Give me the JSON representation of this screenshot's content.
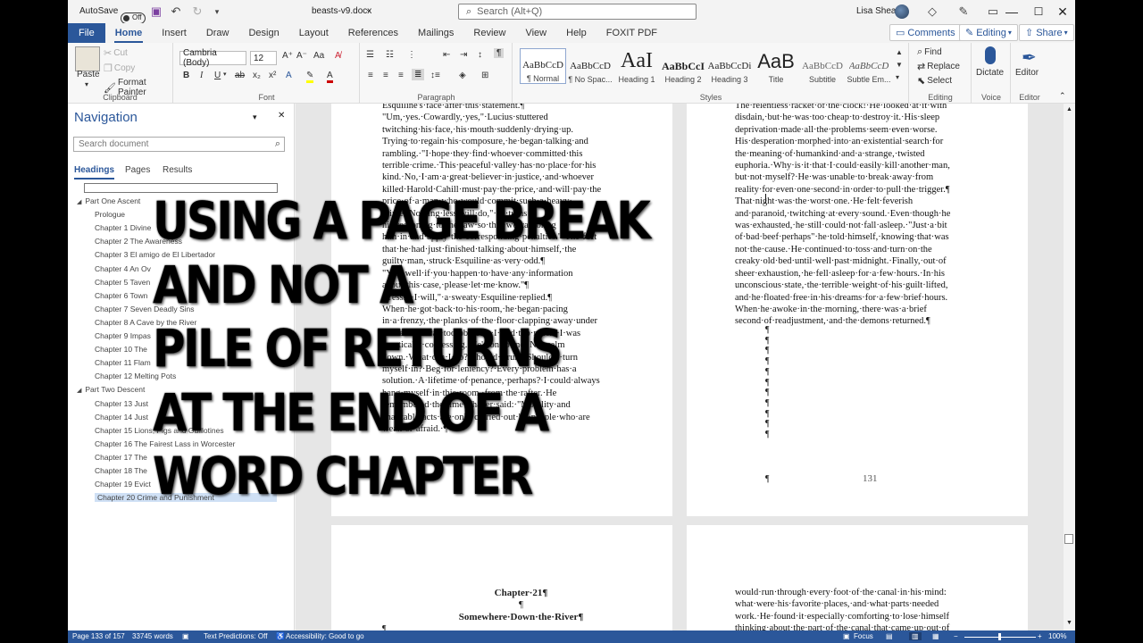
{
  "titlebar": {
    "autosave_label": "AutoSave",
    "autosave_state": "Off",
    "filename": "beasts-v9.docx",
    "search_placeholder": "Search (Alt+Q)",
    "user_name": "Lisa Shea"
  },
  "tabs": [
    "File",
    "Home",
    "Insert",
    "Draw",
    "Design",
    "Layout",
    "References",
    "Mailings",
    "Review",
    "View",
    "Help",
    "FOXIT PDF"
  ],
  "active_tab": "Home",
  "header_buttons": {
    "comments": "Comments",
    "editing": "Editing",
    "share": "Share"
  },
  "ribbon": {
    "clipboard": {
      "paste": "Paste",
      "cut": "Cut",
      "copy": "Copy",
      "format_painter": "Format Painter",
      "label": "Clipboard"
    },
    "font": {
      "family": "Cambria (Body)",
      "size": "12",
      "label": "Font"
    },
    "paragraph": {
      "label": "Paragraph"
    },
    "styles": {
      "label": "Styles",
      "items": [
        {
          "sample": "AaBbCcD",
          "name": "¶ Normal"
        },
        {
          "sample": "AaBbCcD",
          "name": "¶ No Spac..."
        },
        {
          "sample": "AaI",
          "name": "Heading 1"
        },
        {
          "sample": "AaBbCcI",
          "name": "Heading 2"
        },
        {
          "sample": "AaBbCcDi",
          "name": "Heading 3"
        },
        {
          "sample": "AaB",
          "name": "Title"
        },
        {
          "sample": "AaBbCcD",
          "name": "Subtitle"
        },
        {
          "sample": "AaBbCcD",
          "name": "Subtle Em..."
        }
      ]
    },
    "editing": {
      "find": "Find",
      "replace": "Replace",
      "select": "Select",
      "label": "Editing"
    },
    "voice": {
      "dictate": "Dictate",
      "label": "Voice"
    },
    "editor": {
      "editor": "Editor",
      "label": "Editor"
    }
  },
  "navigation": {
    "title": "Navigation",
    "search_placeholder": "Search document",
    "tabs": [
      "Headings",
      "Pages",
      "Results"
    ],
    "active_tab": "Headings",
    "headings": [
      {
        "level": 1,
        "text": "Part One  Ascent"
      },
      {
        "level": 2,
        "text": "Prologue"
      },
      {
        "level": 2,
        "text": "Chapter 1  Divine"
      },
      {
        "level": 2,
        "text": "Chapter 2  The Awareness"
      },
      {
        "level": 2,
        "text": "Chapter 3   El amigo de El Libertador"
      },
      {
        "level": 2,
        "text": "Chapter 4   An Ov"
      },
      {
        "level": 2,
        "text": "Chapter 5  Taven"
      },
      {
        "level": 2,
        "text": "Chapter 6  Town"
      },
      {
        "level": 2,
        "text": "Chapter 7  Seven Deadly Sins"
      },
      {
        "level": 2,
        "text": "Chapter 8  A Cave by the River"
      },
      {
        "level": 2,
        "text": "Chapter 9  Impas"
      },
      {
        "level": 2,
        "text": "Chapter 10  The"
      },
      {
        "level": 2,
        "text": "Chapter 11  Flam"
      },
      {
        "level": 2,
        "text": "Chapter 12  Melting Pots"
      },
      {
        "level": 1,
        "text": "Part Two  Descent"
      },
      {
        "level": 2,
        "text": "Chapter 13  Just"
      },
      {
        "level": 2,
        "text": "Chapter 14  Just"
      },
      {
        "level": 2,
        "text": "Chapter 15  Lions, Pigs and Guillotines"
      },
      {
        "level": 2,
        "text": "Chapter 16  The Fairest Lass in Worcester"
      },
      {
        "level": 2,
        "text": "Chapter 17  The"
      },
      {
        "level": 2,
        "text": "Chapter 18  The"
      },
      {
        "level": 2,
        "text": "Chapter 19  Evict"
      },
      {
        "level": 2,
        "text": "Chapter 20  Crime and Punishment"
      }
    ],
    "selected_index": 22
  },
  "document": {
    "left_page_lines": [
      "Esquiline's·face·after·this·statement.¶",
      "      \"Um,·yes.·Cowardly,·yes,\"·Lucius·stuttered",
      "twitching·his·face,·his·mouth·suddenly·drying·up.",
      "Trying·to·regain·his·composure,·he·began·talking·and",
      "rambling.·\"I·hope·they·find·whoever·committed·this",
      "terrible·crime.·This·peaceful·valley·has·no·place·for·his",
      "kind.·No,·I·am·a·great·believer·in·justice,·and·whoever",
      "killed·Harold·Cahill·must·pay·the·price,·and·will·pay·the",
      "price·of·a·man·who·would·commit·such·a·heavy·",
      "crime.·Nothing·less·will·do,\"·he·turns",
      "his·reasoning·to·the·law·so·that·we·can·bring",
      "him·in·and·apply·the·corresponding·penalties.\"·The·fact",
      "that·he·had·just·finished·talking·about·himself,·the",
      "guilty·man,·struck·Esquiline·as·very·odd.¶",
      "      \"Yes,·well·if·you·happen·to·have·any·information",
      "about·this·case,·please·let·me·know.\"¶",
      "      \"Yessir,·I·will,\"·a·sweaty·Esquiline·replied.¶",
      "      When·he·got·back·to·his·room,·he·began·pacing",
      "in·a·frenzy,·the·planks·of·the·floor·clapping·away·under",
      "his·feet.·\"I·was·too·obvious.·I·said·too·much.·I·was",
      "practically·confessing.·He's·on·to·me.·No,·calm",
      "down.·What·can·I·do?·Should·I·run?·Should·I·turn",
      "myself·in?·Beg·for·leniency?·Every·problem·has·a",
      "solution.·A·lifetime·of·penance,·perhaps?·I·could·always",
      "hang·myself·in·this·room,·from·the·rafter.·He",
      "remembered·the·time·Thayer·said:·\"Morality·and",
      "charitable·acts·are·only·carried·out·by·people·who·are",
      "weak·or·afraid.·¶"
    ],
    "left_page_number": "130",
    "right_page_lines": [
      "The·relentless·racket·of·the·clock!·He·looked·at·it·with",
      "disdain,·but·he·was·too·cheap·to·destroy·it.·His·sleep",
      "deprivation·made·all·the·problems·seem·even·worse.",
      "His·desperation·morphed·into·an·existential·search·for",
      "the·meaning·of·humankind·and·a·strange,·twisted",
      "euphoria.·Why·is·it·that·I·could·easily·kill·another·man,",
      "but·not·myself?·He·was·unable·to·break·away·from",
      "reality·for·even·one·second·in·order·to·pull·the·trigger.¶",
      "      That·night·was·the·worst·one.·He·felt·feverish",
      "and·paranoid,·twitching·at·every·sound.·Even·though·he",
      "was·exhausted,·he·still·could·not·fall·asleep.·\"Just·a·bit",
      "of·bad·beef·perhaps\"·he·told·himself,·knowing·that·was",
      "not·the·cause.·He·continued·to·toss·and·turn·on·the",
      "creaky·old·bed·until·well·past·midnight.·Finally,·out·of",
      "sheer·exhaustion,·he·fell·asleep·for·a·few·hours.·In·his",
      "unconscious·state,·the·terrible·weight·of·his·guilt·lifted,",
      "and·he·floated·free·in·his·dreams·for·a·few·brief·hours.",
      "When·he·awoke·in·the·morning,·there·was·a·brief",
      "second·of·readjustment,·and·the·demons·returned.¶"
    ],
    "pilcrow": "¶",
    "pilcrow_count": 11,
    "right_page_number": "131",
    "next_left_heading": "Chapter·21¶",
    "next_left_blank": "¶",
    "next_left_subtitle": "Somewhere·Down·the·River¶",
    "next_left_cont": "¶",
    "next_right_lines": [
      "would·run·through·every·foot·of·the·canal·in·his·mind:",
      "what·were·his·favorite·places,·and·what·parts·needed",
      "work.·He·found·it·especially·comforting·to·lose·himself",
      "thinking·about·the·part·of·the·canal·that·came·up·out·of"
    ]
  },
  "statusbar": {
    "page": "Page 133 of 157",
    "words": "33745 words",
    "text_predictions": "Text Predictions: Off",
    "accessibility": "Accessibility: Good to go",
    "focus": "Focus",
    "zoom": "100%"
  },
  "overlay": {
    "lines": [
      "USING A PAGE BREAK",
      "AND NOT A",
      "PILE OF RETURNS",
      "AT THE END OF A",
      "WORD CHAPTER"
    ]
  },
  "colors": {
    "accent": "#2b579a",
    "nav_selected": "#cfe0f5"
  }
}
